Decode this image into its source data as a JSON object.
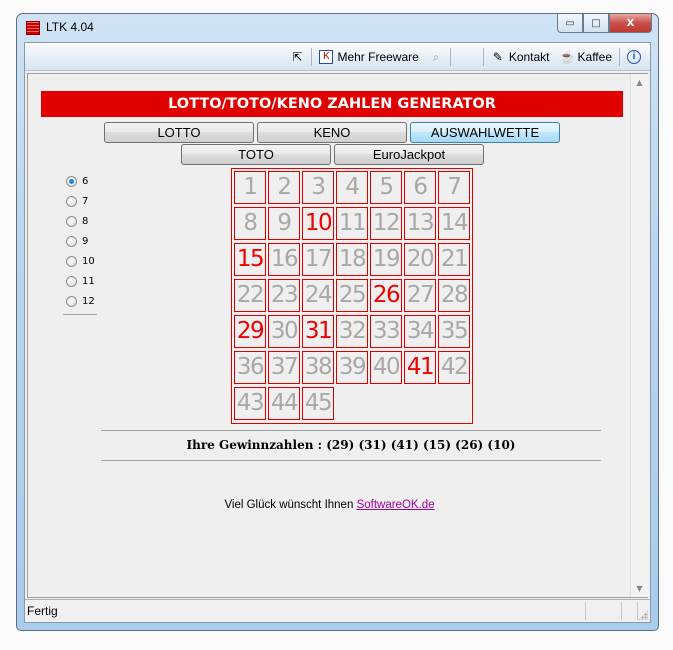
{
  "window": {
    "title": "LTK 4.04",
    "controls": {
      "minimize": "▭",
      "maximize": "□",
      "close": "X"
    }
  },
  "toolbar": {
    "items": [
      {
        "icon": "shortcut-icon",
        "label": ""
      },
      {
        "icon": "freeware-icon",
        "label": "Mehr Freeware"
      },
      {
        "icon": "search-doc-icon",
        "label": ""
      },
      {
        "icon": "edit-icon",
        "label": "Kontakt"
      },
      {
        "icon": "coffee-icon",
        "label": "Kaffee"
      },
      {
        "icon": "info-icon",
        "label": ""
      }
    ]
  },
  "banner": {
    "title": "LOTTO/TOTO/KENO ZAHLEN GENERATOR"
  },
  "mode_buttons": [
    {
      "label": "LOTTO",
      "focused": false
    },
    {
      "label": "KENO",
      "focused": false
    },
    {
      "label": "AUSWAHLWETTE",
      "focused": true
    },
    {
      "label": "TOTO",
      "focused": false
    },
    {
      "label": "EuroJackpot",
      "focused": false
    }
  ],
  "count_options": {
    "selected": "6",
    "options": [
      "6",
      "7",
      "8",
      "9",
      "10",
      "11",
      "12"
    ]
  },
  "number_grid": {
    "max": 45,
    "columns": 7,
    "drawn": [
      29,
      31,
      41,
      15,
      26,
      10
    ],
    "colors": {
      "drawn": "#f00000",
      "normal": "#a8a8a8",
      "border": "#e00000"
    }
  },
  "result": {
    "label": "Ihre Gewinnzahlen :",
    "numbers_text": "(29) (31) (41) (15) (26) (10)"
  },
  "footer": {
    "text": "Viel Glück wünscht Ihnen",
    "link": "SoftwareOK.de"
  },
  "status": {
    "text": "Fertig"
  }
}
